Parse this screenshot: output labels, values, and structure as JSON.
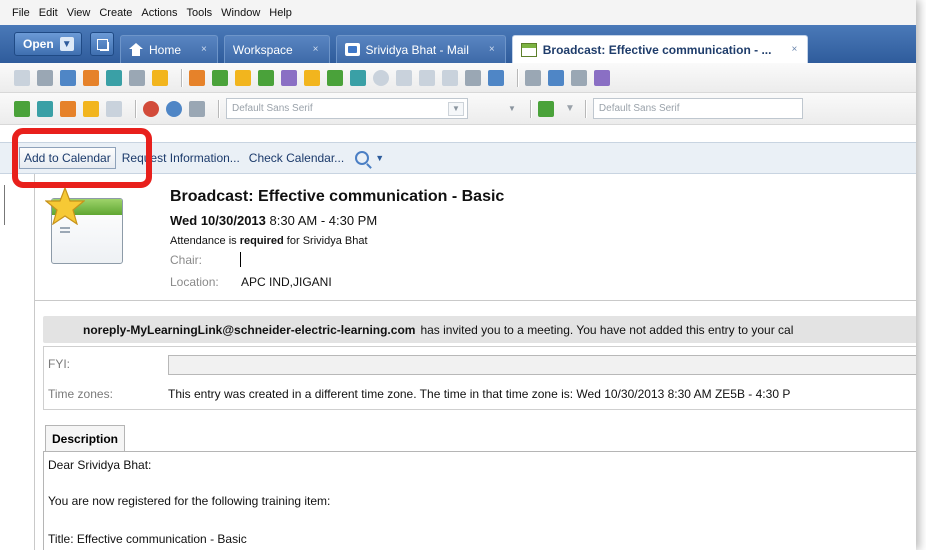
{
  "menu": [
    "File",
    "Edit",
    "View",
    "Create",
    "Actions",
    "Tools",
    "Window",
    "Help"
  ],
  "tabs": {
    "open_label": "Open",
    "items": [
      {
        "label": "Home",
        "icon": "home-icon"
      },
      {
        "label": "Workspace",
        "icon": ""
      },
      {
        "label": "Srividya Bhat - Mail",
        "icon": "mail-icon"
      },
      {
        "label": "Broadcast: Effective communication - ...",
        "icon": "calendar-icon",
        "active": true
      }
    ],
    "close_glyph": "×"
  },
  "toolbar2": {
    "font1": "Default Sans Serif",
    "font2": "Default Sans Serif"
  },
  "actions": {
    "add_to_calendar": "Add to Calendar",
    "request_information": "Request Information...",
    "check_calendar": "Check Calendar..."
  },
  "entry": {
    "title": "Broadcast: Effective communication - Basic",
    "date": "Wed 10/30/2013",
    "time": "8:30 AM - 4:30 PM",
    "attendance_prefix": "Attendance is",
    "attendance_required": "required",
    "attendance_suffix": "for Srividya Bhat",
    "chair_label": "Chair:",
    "location_label": "Location:",
    "location_value": "APC IND,JIGANI"
  },
  "invite": {
    "sender": "noreply-MyLearningLink@schneider-electric-learning.com",
    "message": "has invited you to a meeting.  You have not added this entry to your cal"
  },
  "info": {
    "fyi_label": "FYI:",
    "timezones_label": "Time zones:",
    "timezones_text": "This entry was created in a different time zone.  The time in that time zone is: Wed 10/30/2013 8:30 AM ZE5B - 4:30 P"
  },
  "description": {
    "tab_label": "Description",
    "lines": [
      "Dear Srividya Bhat:",
      "You are now registered for the following training item:",
      "Title: Effective communication - Basic"
    ]
  },
  "colors": {
    "tab_bar": "#3d6aa8",
    "highlight": "#e8201c",
    "link_text": "#1b3a6b"
  }
}
